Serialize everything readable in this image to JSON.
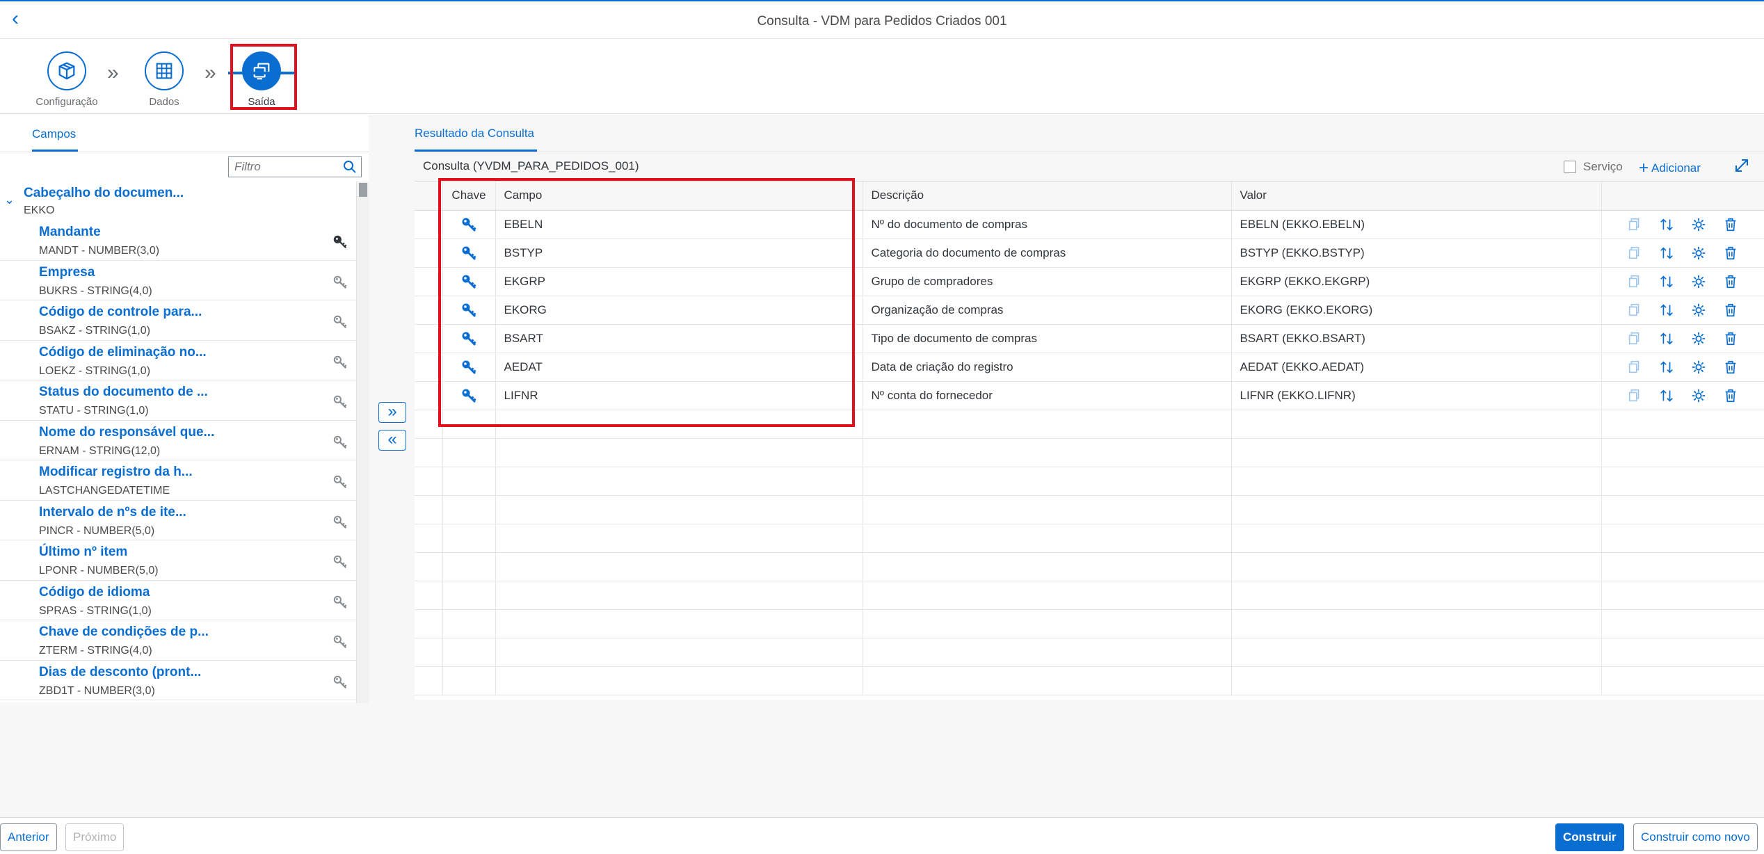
{
  "shell": {
    "title": "Consulta - VDM para Pedidos Criados 001"
  },
  "wizard": {
    "steps": [
      {
        "label": "Configuração",
        "icon": "box-icon"
      },
      {
        "label": "Dados",
        "icon": "table-icon"
      },
      {
        "label": "Saída",
        "icon": "output-icon"
      }
    ]
  },
  "left": {
    "tab": "Campos",
    "filter_placeholder": "Filtro",
    "group": {
      "title": "Cabeçalho do documen...",
      "subtitle": "EKKO"
    },
    "items": [
      {
        "title": "Mandante",
        "sub": "MANDT - NUMBER(3,0)",
        "key": true
      },
      {
        "title": "Empresa",
        "sub": "BUKRS - STRING(4,0)",
        "key": false
      },
      {
        "title": "Código de controle para...",
        "sub": "BSAKZ - STRING(1,0)",
        "key": false
      },
      {
        "title": "Código de eliminação no...",
        "sub": "LOEKZ - STRING(1,0)",
        "key": false
      },
      {
        "title": "Status do documento de ...",
        "sub": "STATU - STRING(1,0)",
        "key": false
      },
      {
        "title": "Nome do responsável que...",
        "sub": "ERNAM - STRING(12,0)",
        "key": false
      },
      {
        "title": "Modificar registro da h...",
        "sub": "LASTCHANGEDATETIME",
        "key": false
      },
      {
        "title": "Intervalo de nºs de ite...",
        "sub": "PINCR - NUMBER(5,0)",
        "key": false
      },
      {
        "title": "Último nº item",
        "sub": "LPONR - NUMBER(5,0)",
        "key": false
      },
      {
        "title": "Código de idioma",
        "sub": "SPRAS - STRING(1,0)",
        "key": false
      },
      {
        "title": "Chave de condições de p...",
        "sub": "ZTERM - STRING(4,0)",
        "key": false
      },
      {
        "title": "Dias de desconto (pront...",
        "sub": "ZBD1T - NUMBER(3,0)",
        "key": false
      }
    ]
  },
  "move": {
    "add": "»",
    "remove": "«"
  },
  "right": {
    "tab": "Resultado da Consulta",
    "query_title": "Consulta (YVDM_PARA_PEDIDOS_001)",
    "servico_label": "Serviço",
    "adicionar_label": "Adicionar",
    "columns": [
      "Chave",
      "Campo",
      "Descrição",
      "Valor"
    ],
    "rows": [
      {
        "campo": "EBELN",
        "descricao": "Nº do documento de compras",
        "valor": "EBELN (EKKO.EBELN)"
      },
      {
        "campo": "BSTYP",
        "descricao": "Categoria do documento de compras",
        "valor": "BSTYP (EKKO.BSTYP)"
      },
      {
        "campo": "EKGRP",
        "descricao": "Grupo de compradores",
        "valor": "EKGRP (EKKO.EKGRP)"
      },
      {
        "campo": "EKORG",
        "descricao": "Organização de compras",
        "valor": "EKORG (EKKO.EKORG)"
      },
      {
        "campo": "BSART",
        "descricao": "Tipo de documento de compras",
        "valor": "BSART (EKKO.BSART)"
      },
      {
        "campo": "AEDAT",
        "descricao": "Data de criação do registro",
        "valor": "AEDAT (EKKO.AEDAT)"
      },
      {
        "campo": "LIFNR",
        "descricao": "Nº conta do fornecedor",
        "valor": "LIFNR (EKKO.LIFNR)"
      }
    ],
    "empty_rows": 10
  },
  "footer": {
    "anterior": "Anterior",
    "proximo": "Próximo",
    "construir": "Construir",
    "construir_novo": "Construir como novo"
  },
  "colors": {
    "accent": "#0a6ed1",
    "highlight": "#e2101e"
  }
}
